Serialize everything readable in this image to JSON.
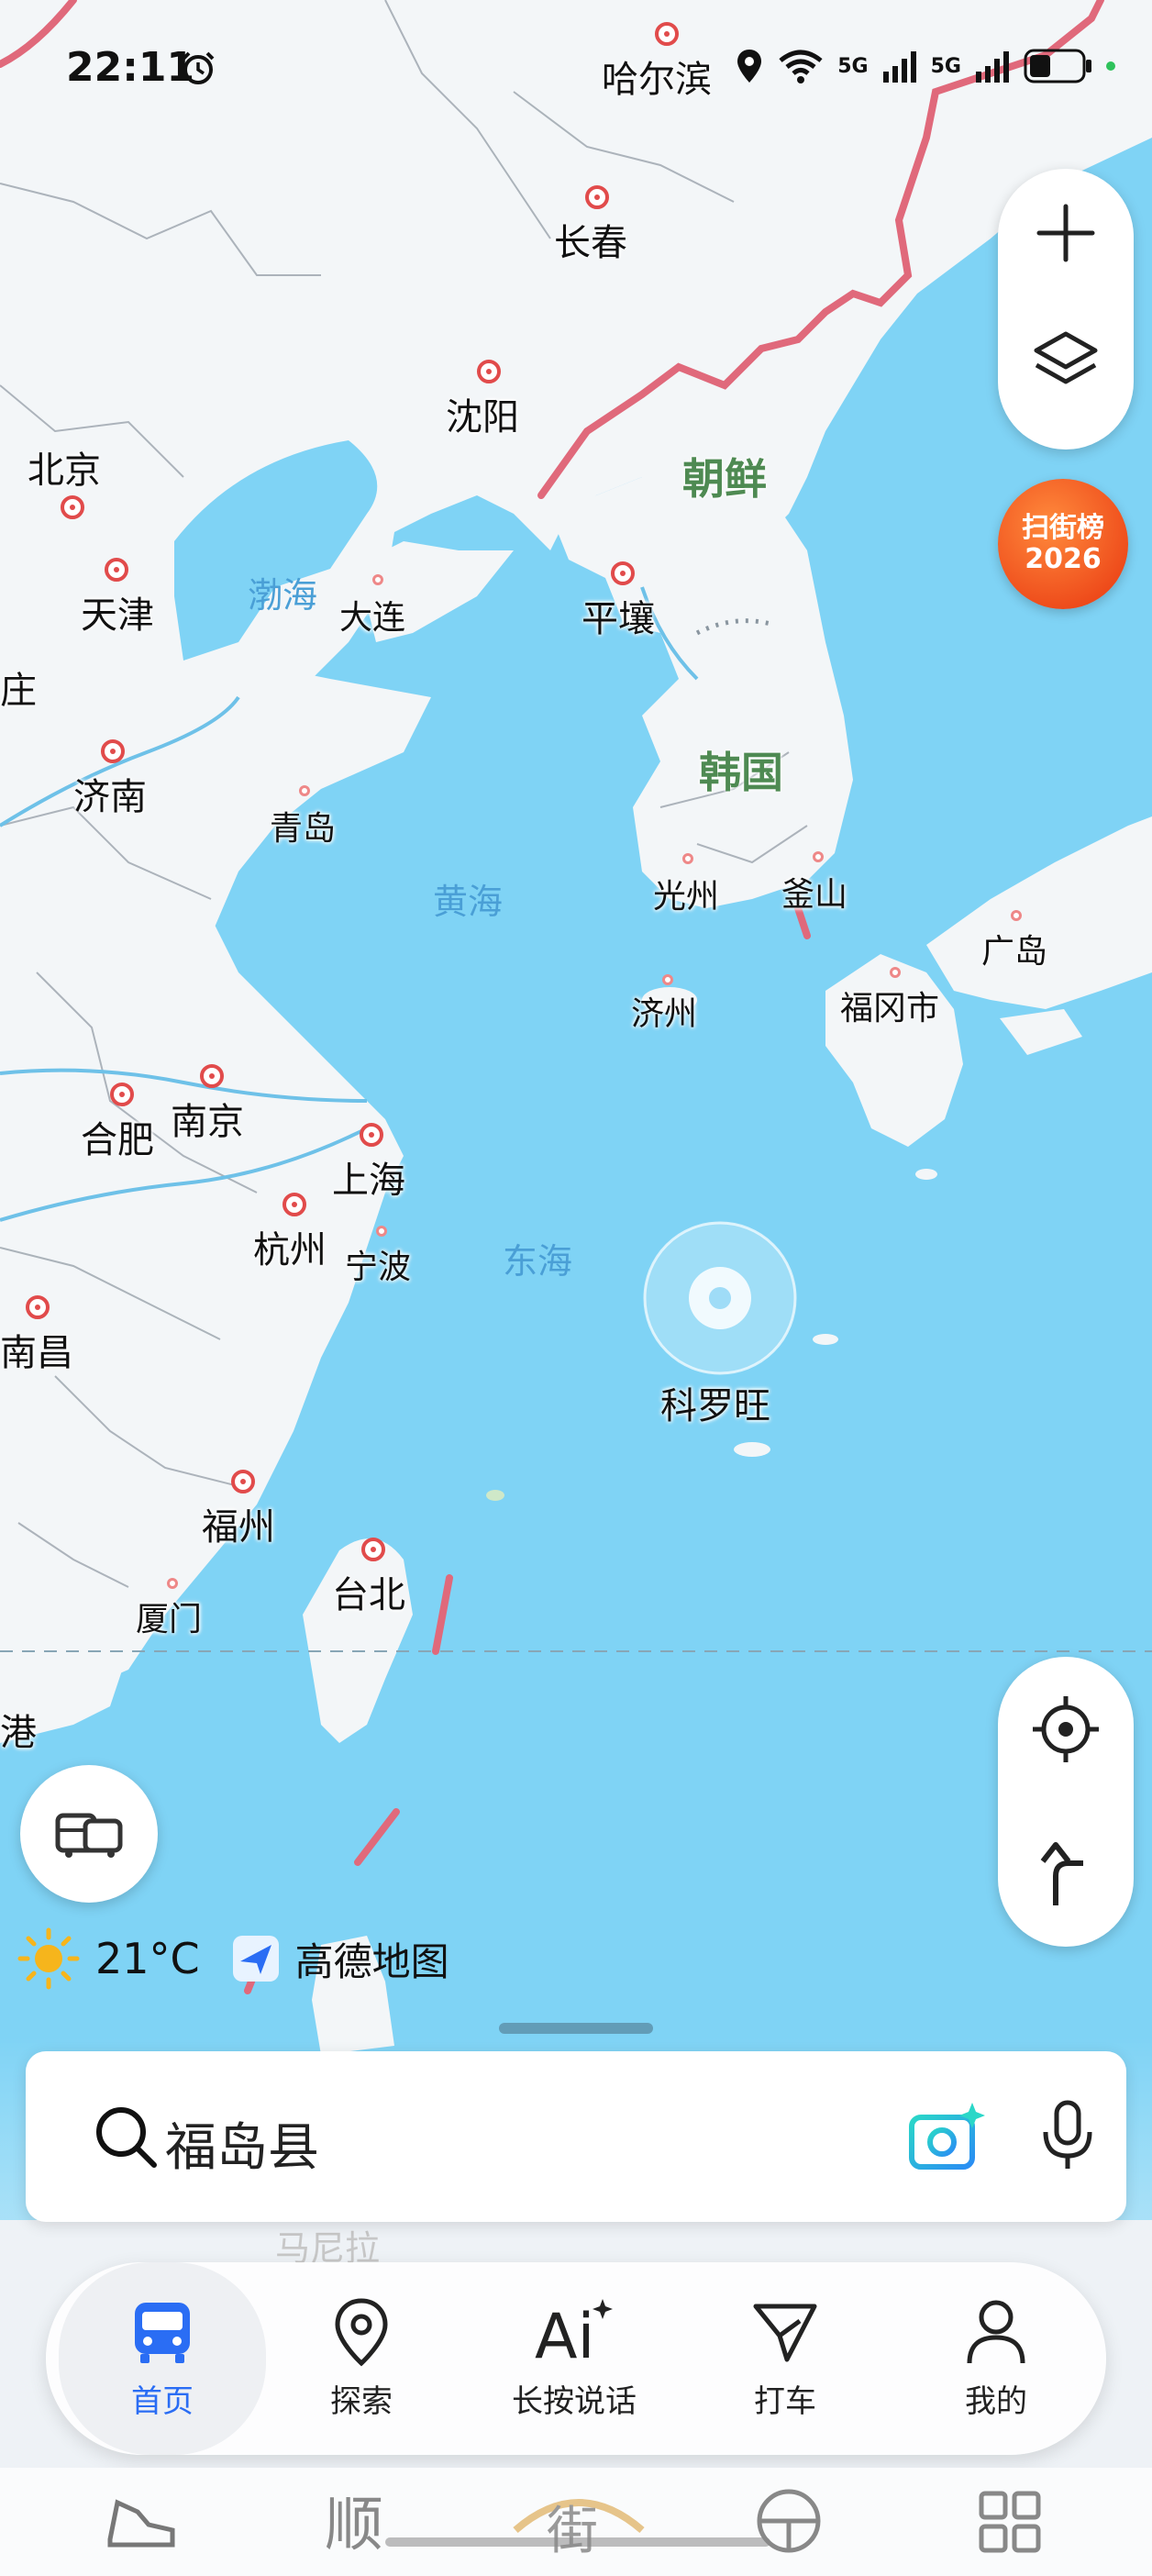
{
  "status_bar": {
    "time": "22:11",
    "location": "哈尔滨",
    "signal1": "5G",
    "signal2": "5G"
  },
  "map": {
    "cities": [
      {
        "name": "哈尔滨"
      },
      {
        "name": "长春"
      },
      {
        "name": "沈阳"
      },
      {
        "name": "北京"
      },
      {
        "name": "天津"
      },
      {
        "name": "大连"
      },
      {
        "name": "平壤"
      },
      {
        "name": "济南"
      },
      {
        "name": "青岛"
      },
      {
        "name": "光州"
      },
      {
        "name": "釜山"
      },
      {
        "name": "济州"
      },
      {
        "name": "福冈市"
      },
      {
        "name": "广岛"
      },
      {
        "name": "合肥"
      },
      {
        "name": "南京"
      },
      {
        "name": "上海"
      },
      {
        "name": "杭州"
      },
      {
        "name": "宁波"
      },
      {
        "name": "南昌"
      },
      {
        "name": "福州"
      },
      {
        "name": "厦门"
      },
      {
        "name": "台北"
      },
      {
        "name": "港"
      },
      {
        "name": "庄"
      }
    ],
    "countries": [
      "朝鲜",
      "韩国"
    ],
    "seas": [
      "渤海",
      "黄海",
      "东海"
    ],
    "typhoon": "科罗旺",
    "faded_label": "马尼拉"
  },
  "controls": {
    "zoom_in_icon": "plus-icon",
    "layers_icon": "layers-icon",
    "ranking_line1": "扫街榜",
    "ranking_line2": "2026",
    "locate_icon": "crosshair-icon",
    "navigate_icon": "turn-arrow-icon",
    "vehicle_icon": "bus-car-icon"
  },
  "weather": {
    "temp": "21°C"
  },
  "brand": {
    "name": "高德地图"
  },
  "search": {
    "text": "福岛县"
  },
  "nav": {
    "items": [
      {
        "label": "首页",
        "icon": "bus-icon",
        "active": true
      },
      {
        "label": "探索",
        "icon": "location-pin-icon"
      },
      {
        "label": "长按说话",
        "icon": "ai-icon"
      },
      {
        "label": "打车",
        "icon": "taxi-arrow-icon"
      },
      {
        "label": "我的",
        "icon": "user-icon"
      }
    ]
  },
  "colors": {
    "sea": "#7fd3f5",
    "land": "#f3f6f8",
    "border": "#e0697b",
    "accent": "#2a6df4"
  }
}
